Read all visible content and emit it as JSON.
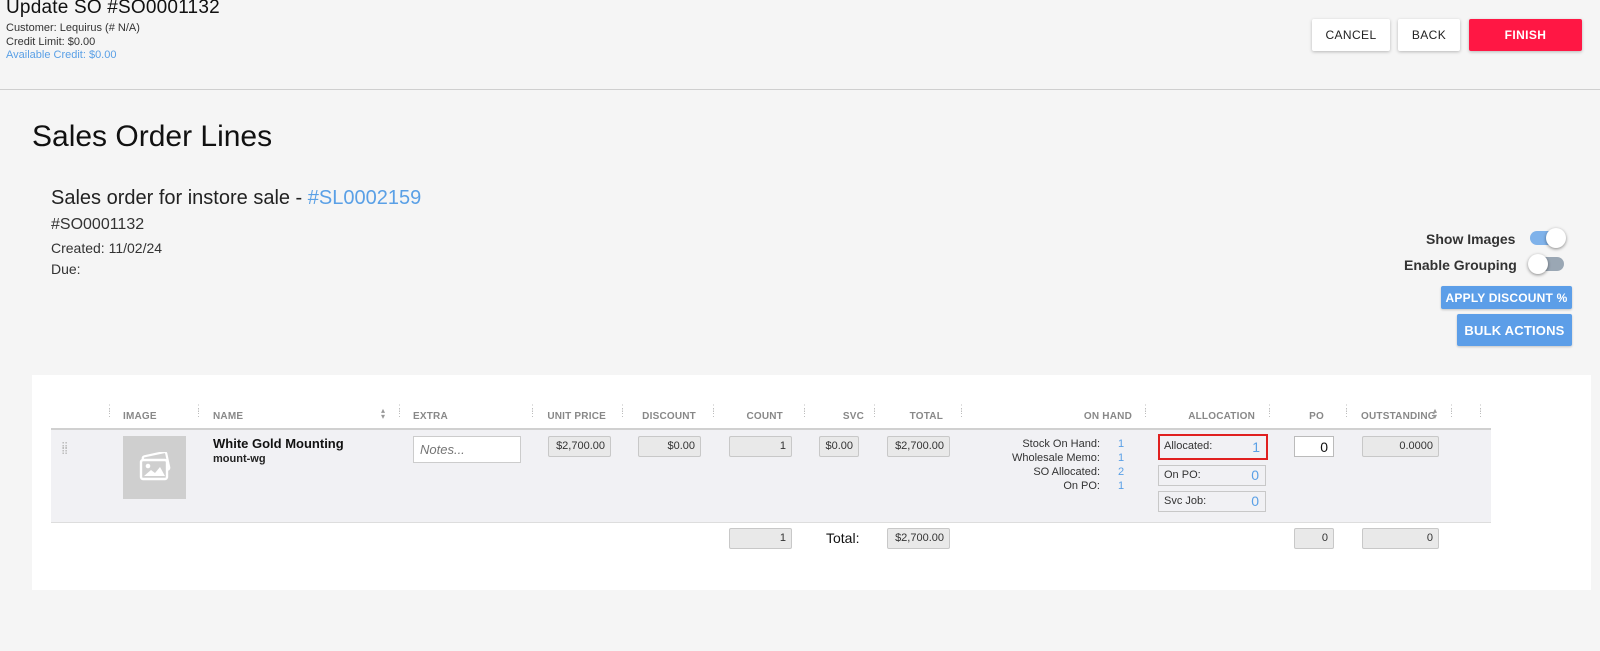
{
  "header": {
    "title": "Update SO #SO0001132",
    "customer": "Customer: Lequirus (# N/A)",
    "credit_limit": "Credit Limit: $0.00",
    "available_credit": "Available Credit: $0.00",
    "cancel_label": "CANCEL",
    "back_label": "BACK",
    "finish_label": "FINISH"
  },
  "section": {
    "title": "Sales Order Lines",
    "order_heading_prefix": "Sales order for instore sale - ",
    "order_link": "#SL0002159",
    "order_number": "#SO0001132",
    "created": "Created: 11/02/24",
    "due": "Due:"
  },
  "controls": {
    "show_images_label": "Show Images",
    "show_images_on": true,
    "enable_grouping_label": "Enable Grouping",
    "enable_grouping_on": false,
    "apply_discount_label": "APPLY DISCOUNT %",
    "bulk_actions_label": "BULK ACTIONS"
  },
  "table": {
    "columns": [
      "IMAGE",
      "NAME",
      "EXTRA",
      "UNIT PRICE",
      "DISCOUNT",
      "COUNT",
      "SVC",
      "TOTAL",
      "ON HAND",
      "ALLOCATION",
      "PO",
      "OUTSTANDING"
    ],
    "row": {
      "name": "White Gold Mounting",
      "sku": "mount-wg",
      "notes_placeholder": "Notes...",
      "unit_price": "$2,700.00",
      "discount": "$0.00",
      "count": "1",
      "svc": "$0.00",
      "total": "$2,700.00",
      "on_hand": [
        {
          "label": "Stock On Hand:",
          "value": "1"
        },
        {
          "label": "Wholesale Memo:",
          "value": "1"
        },
        {
          "label": "SO Allocated:",
          "value": "2"
        },
        {
          "label": "On PO:",
          "value": "1"
        }
      ],
      "allocation": [
        {
          "label": "Allocated:",
          "value": "1"
        },
        {
          "label": "On PO:",
          "value": "0"
        },
        {
          "label": "Svc Job:",
          "value": "0"
        }
      ],
      "po": "0",
      "outstanding": "0.0000"
    },
    "footer": {
      "count": "1",
      "total_label": "Total:",
      "total": "$2,700.00",
      "po": "0",
      "outstanding": "0"
    }
  }
}
